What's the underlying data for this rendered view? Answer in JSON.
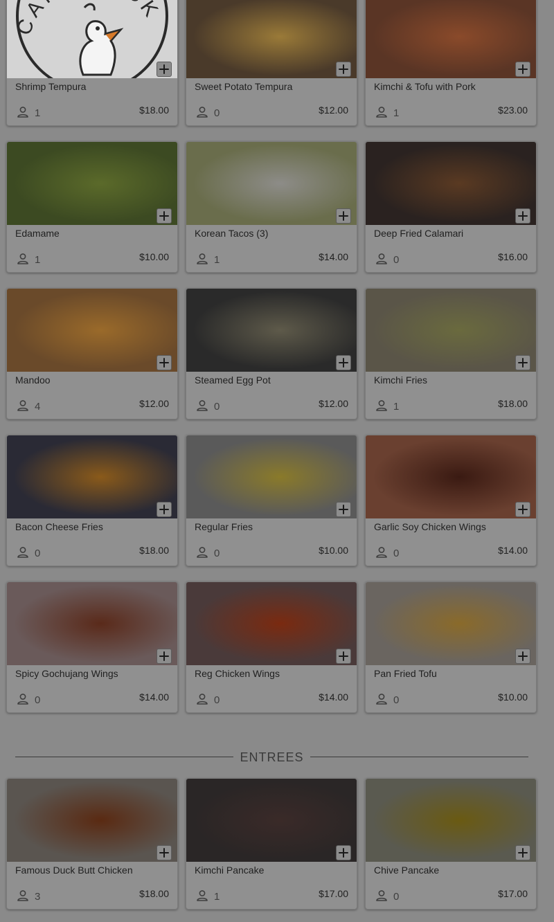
{
  "sections": [
    {
      "title": "",
      "items": [
        {
          "name": "Shrimp Tempura",
          "count": "1",
          "price": "$18.00",
          "image": "logo",
          "colors": [
            "#cfcfcf",
            "#bdbdbd"
          ]
        },
        {
          "name": "Sweet Potato Tempura",
          "count": "0",
          "price": "$12.00",
          "image": "photo",
          "colors": [
            "#9a7a38",
            "#4a3a2a"
          ]
        },
        {
          "name": "Kimchi & Tofu with Pork",
          "count": "1",
          "price": "$23.00",
          "image": "photo",
          "colors": [
            "#8a4a2a",
            "#5a3525"
          ]
        },
        {
          "name": "Edamame",
          "count": "1",
          "price": "$10.00",
          "image": "photo",
          "colors": [
            "#5b6a2a",
            "#3c4a22"
          ]
        },
        {
          "name": "Korean Tacos (3)",
          "count": "1",
          "price": "$14.00",
          "image": "photo",
          "colors": [
            "#8d8c88",
            "#6a6d4c"
          ]
        },
        {
          "name": "Deep Fried Calamari",
          "count": "0",
          "price": "$16.00",
          "image": "photo",
          "colors": [
            "#5a3a22",
            "#2a2220"
          ]
        },
        {
          "name": "Mandoo",
          "count": "4",
          "price": "$12.00",
          "image": "photo",
          "colors": [
            "#9a6a2a",
            "#6a4a2a"
          ]
        },
        {
          "name": "Steamed Egg Pot",
          "count": "0",
          "price": "$12.00",
          "image": "photo",
          "colors": [
            "#5e5a4a",
            "#2a2a2a"
          ]
        },
        {
          "name": "Kimchi Fries",
          "count": "1",
          "price": "$18.00",
          "image": "photo",
          "colors": [
            "#6a6a3e",
            "#5a5548"
          ]
        },
        {
          "name": "Bacon Cheese Fries",
          "count": "0",
          "price": "$18.00",
          "image": "photo",
          "colors": [
            "#8a5a1a",
            "#2a2a35"
          ]
        },
        {
          "name": "Regular Fries",
          "count": "0",
          "price": "$10.00",
          "image": "photo",
          "colors": [
            "#8a7a2a",
            "#5a5a5a"
          ]
        },
        {
          "name": "Garlic Soy Chicken Wings",
          "count": "0",
          "price": "$14.00",
          "image": "photo",
          "colors": [
            "#3a1a12",
            "#6a4030"
          ]
        },
        {
          "name": "Spicy Gochujang Wings",
          "count": "0",
          "price": "$14.00",
          "image": "photo",
          "colors": [
            "#5a2a1a",
            "#6a5a5a"
          ]
        },
        {
          "name": "Reg Chicken Wings",
          "count": "0",
          "price": "$14.00",
          "image": "photo",
          "colors": [
            "#7a2a10",
            "#4a3a3a"
          ]
        },
        {
          "name": "Pan Fried Tofu",
          "count": "0",
          "price": "$10.00",
          "image": "photo",
          "colors": [
            "#8a6a2a",
            "#6a6560"
          ]
        }
      ]
    },
    {
      "title": "ENTREES",
      "items": [
        {
          "name": "Famous Duck Butt Chicken",
          "count": "3",
          "price": "$18.00",
          "image": "photo",
          "colors": [
            "#5a2a12",
            "#5a5550"
          ]
        },
        {
          "name": "Kimchi Pancake",
          "count": "1",
          "price": "$17.00",
          "image": "photo",
          "colors": [
            "#3a2a28",
            "#2a2626"
          ]
        },
        {
          "name": "Chive Pancake",
          "count": "0",
          "price": "$17.00",
          "image": "photo",
          "colors": [
            "#6a5a12",
            "#5a5a50"
          ]
        }
      ]
    }
  ],
  "logo_text": "CAFE DUCK BUTT",
  "overlay": {
    "color": "#000000",
    "opacity": 0.45
  },
  "icons": {
    "add": "plus-square-icon",
    "count": "person-icon"
  }
}
